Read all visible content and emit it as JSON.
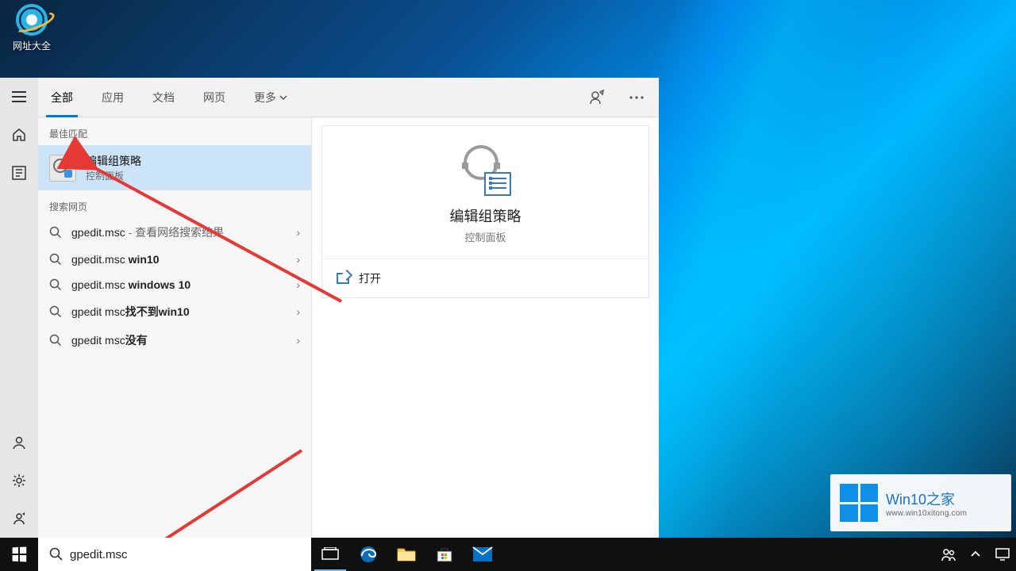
{
  "desktop": {
    "shortcut_label": "网址大全"
  },
  "search": {
    "input_value": "gpedit.msc",
    "tabs": [
      "全部",
      "应用",
      "文档",
      "网页"
    ],
    "more_label": "更多",
    "section_best": "最佳匹配",
    "section_web": "搜索网页",
    "best_match": {
      "title": "编辑组策略",
      "subtitle": "控制面板"
    },
    "web_results": [
      {
        "query": "gpedit.msc",
        "suffix": " - 查看网络搜索结果",
        "bold": ""
      },
      {
        "query": "gpedit.msc ",
        "suffix": "",
        "bold": "win10"
      },
      {
        "query": "gpedit.msc ",
        "suffix": "",
        "bold": "windows 10"
      },
      {
        "query": "gpedit msc",
        "suffix": "",
        "bold": "找不到win10"
      },
      {
        "query": "gpedit msc",
        "suffix": "",
        "bold": "没有"
      }
    ],
    "preview": {
      "title": "编辑组策略",
      "subtitle": "控制面板",
      "open_label": "打开"
    }
  },
  "watermark": {
    "line1": "Win10之家",
    "line2": "www.win10xitong.com"
  }
}
